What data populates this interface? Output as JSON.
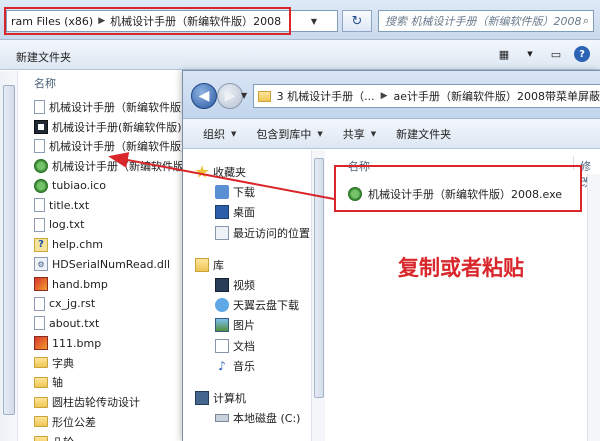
{
  "back_window": {
    "address_parts": [
      "ram Files (x86)",
      "机械设计手册（新编软件版）2008"
    ],
    "search_placeholder": "搜索 机械设计手册（新编软件版）2008",
    "toolbar": {
      "new_folder": "新建文件夹"
    },
    "column_name": "名称",
    "files": [
      {
        "name": "机械设计手册（新编软件版）",
        "icon": "doc-icon"
      },
      {
        "name": "机械设计手册(新编软件版)",
        "icon": "exe-dark-icon"
      },
      {
        "name": "机械设计手册（新编软件版）",
        "icon": "doc-icon"
      },
      {
        "name": "机械设计手册（新编软件版）",
        "icon": "green-app-icon"
      },
      {
        "name": "tubiao.ico",
        "icon": "green-app-icon"
      },
      {
        "name": "title.txt",
        "icon": "doc-icon"
      },
      {
        "name": "log.txt",
        "icon": "doc-icon"
      },
      {
        "name": "help.chm",
        "icon": "help-icon"
      },
      {
        "name": "HDSerialNumRead.dll",
        "icon": "dll-icon"
      },
      {
        "name": "hand.bmp",
        "icon": "bmp-icon"
      },
      {
        "name": "cx_jg.rst",
        "icon": "doc-icon"
      },
      {
        "name": "about.txt",
        "icon": "doc-icon"
      },
      {
        "name": "111.bmp",
        "icon": "bmp-icon"
      },
      {
        "name": "字典",
        "icon": "folder-icon"
      },
      {
        "name": "轴",
        "icon": "folder-icon"
      },
      {
        "name": "圆柱齿轮传动设计",
        "icon": "folder-icon"
      },
      {
        "name": "形位公差",
        "icon": "folder-icon"
      },
      {
        "name": "凸轮",
        "icon": "folder-icon"
      }
    ]
  },
  "front_window": {
    "address_parts": [
      "3 机械设计手册（...",
      "ae计手册（新编软件版）2008带菜单屏蔽"
    ],
    "toolbar": {
      "organize": "组织",
      "include_in_library": "包含到库中",
      "share": "共享",
      "new_folder": "新建文件夹"
    },
    "nav_pane": {
      "favorites": "收藏夹",
      "favorites_items": [
        "下载",
        "桌面",
        "最近访问的位置"
      ],
      "libraries": "库",
      "libraries_items": [
        "视频",
        "天翼云盘下载",
        "图片",
        "文档",
        "音乐"
      ],
      "computer": "计算机",
      "computer_items": [
        "本地磁盘 (C:)"
      ]
    },
    "column_name": "名称",
    "column_modified": "修改",
    "file": "机械设计手册（新编软件版）2008.exe"
  },
  "annotation": {
    "text": "复制或者粘贴"
  },
  "colors": {
    "accent_red": "#d9262a"
  }
}
